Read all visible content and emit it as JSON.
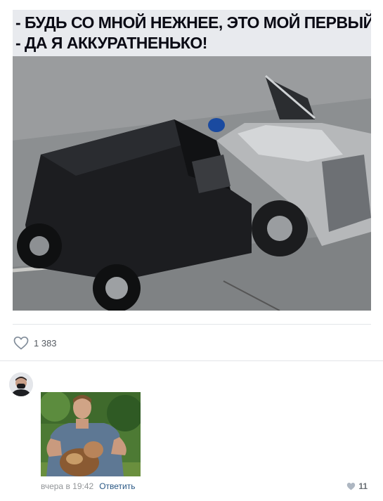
{
  "post": {
    "caption_line1": "- БУДЬ СО МНОЙ НЕЖНЕЕ, ЭТО МОЙ ПЕРВЫЙ РАЗ",
    "caption_line2": "- ДА Я АККУРАТНЕНЬКО!",
    "likes_count": "1 383"
  },
  "comment": {
    "time": "вчера в 19:42",
    "reply_label": "Ответить",
    "likes_count": "11"
  },
  "icons": {
    "like": "heart-outline-icon",
    "comment_like": "heart-filled-icon"
  },
  "colors": {
    "link": "#2a5885",
    "meta": "#939699",
    "divider": "#e3e5e8"
  }
}
